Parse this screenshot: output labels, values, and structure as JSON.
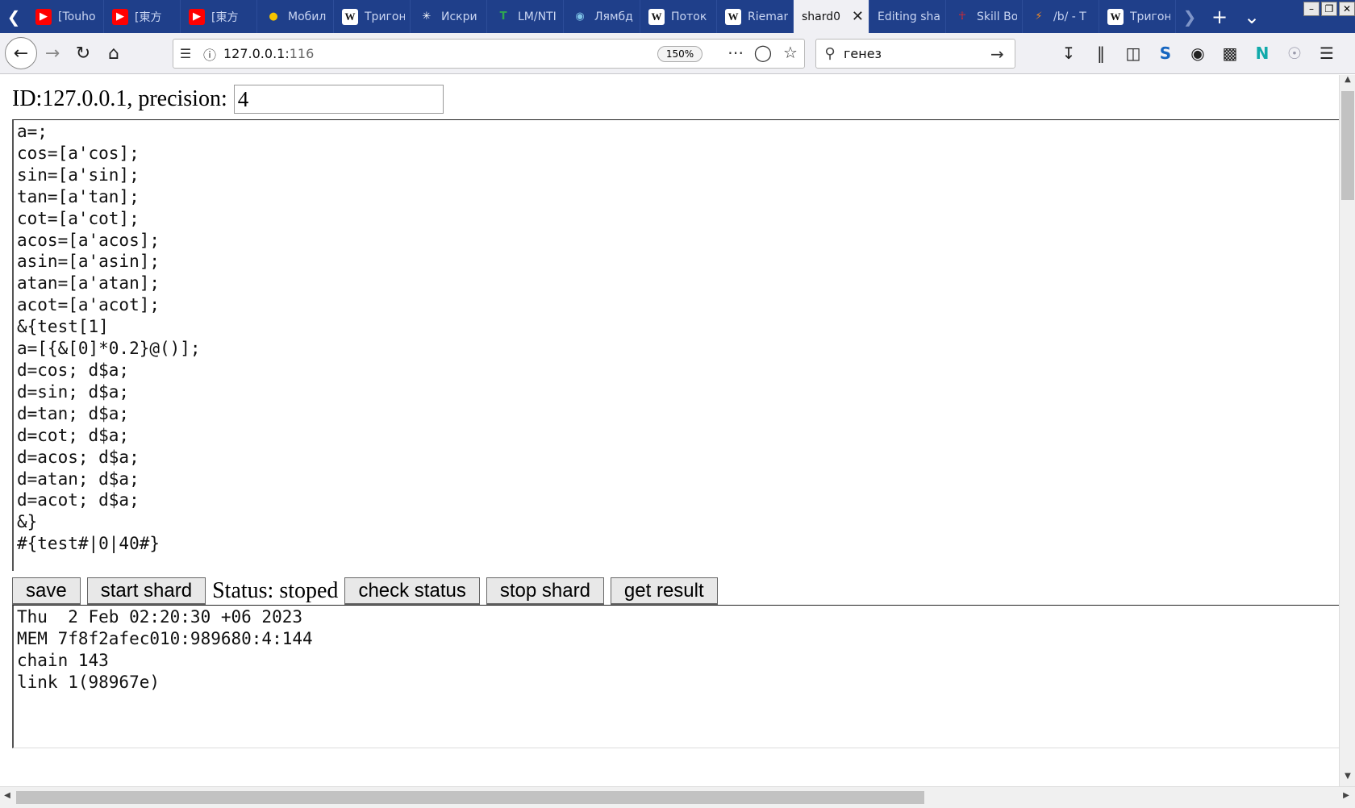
{
  "tabs": [
    {
      "label": "[Touho",
      "icon": "youtube-icon",
      "color": "#ff0000"
    },
    {
      "label": "[東方",
      "icon": "youtube-icon",
      "color": "#ff0000"
    },
    {
      "label": "[東方",
      "icon": "youtube-icon",
      "color": "#ff0000"
    },
    {
      "label": "Мобил",
      "icon": "beeline-icon",
      "color": "#f5c400"
    },
    {
      "label": "Тригон",
      "icon": "wikipedia-icon",
      "color": "#ffffff"
    },
    {
      "label": "Искри",
      "icon": "sparks-icon",
      "color": "#ffffff"
    },
    {
      "label": "LM/NTI",
      "icon": "t-icon",
      "color": "#2fa84f"
    },
    {
      "label": "Лямбд",
      "icon": "lambda-site-icon",
      "color": "#7fc4e8"
    },
    {
      "label": "Поток",
      "icon": "wikipedia-icon",
      "color": "#ffffff"
    },
    {
      "label": "Rieman",
      "icon": "wikipedia-icon",
      "color": "#ffffff"
    },
    {
      "label": "shard0",
      "icon": "",
      "color": "",
      "active": true
    },
    {
      "label": "Editing shar",
      "icon": "",
      "color": ""
    },
    {
      "label": "Skill Bo",
      "icon": "ankh-icon",
      "color": "#e0282d"
    },
    {
      "label": "/b/ - Т",
      "icon": "bolt-icon",
      "color": "#f08a24"
    },
    {
      "label": "Тригон",
      "icon": "wikipedia-icon",
      "color": "#ffffff"
    }
  ],
  "toolbar": {
    "url_host": "127.0.0.1:",
    "url_port": "116",
    "zoom": "150%",
    "search_value": "генез"
  },
  "page": {
    "id_label": "ID:127.0.0.1, precision:",
    "precision_value": "4",
    "code_lines": [
      "a=;",
      "cos=[a'cos];",
      "sin=[a'sin];",
      "tan=[a'tan];",
      "cot=[a'cot];",
      "acos=[a'acos];",
      "asin=[a'asin];",
      "atan=[a'atan];",
      "acot=[a'acot];",
      "&{test[1]",
      "a=[{&[0]*0.2}@()];",
      "d=cos; d$a;",
      "d=sin; d$a;",
      "d=tan; d$a;",
      "d=cot; d$a;",
      "d=acos; d$a;",
      "d=atan; d$a;",
      "d=acot; d$a;",
      "&}",
      "#{test#|0|40#}"
    ],
    "buttons": {
      "save": "save",
      "start_shard": "start shard",
      "check_status": "check status",
      "stop_shard": "stop shard",
      "get_result": "get result"
    },
    "status_text": "Status: stoped",
    "output_lines": [
      "Thu  2 Feb 02:20:30 +06 2023",
      "MEM 7f8f2afec010:989680:4:144",
      "chain 143",
      "link 1(98967e)"
    ]
  }
}
